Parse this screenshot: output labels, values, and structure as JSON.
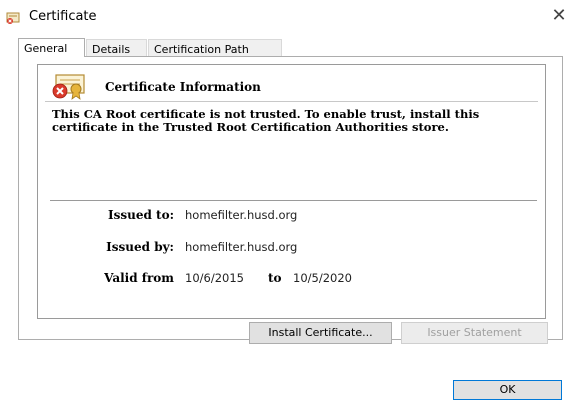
{
  "window": {
    "title": "Certificate",
    "close_glyph": "✕",
    "title_icon": "certificate-icon"
  },
  "tabs": [
    {
      "label": "General",
      "selected": true
    },
    {
      "label": "Details",
      "selected": false
    },
    {
      "label": "Certification Path",
      "selected": false
    }
  ],
  "general": {
    "heading": "Certificate Information",
    "status_icon": "certificate-untrusted-icon",
    "message": "This CA Root certificate is not trusted. To enable trust, install this certificate in the Trusted Root Certification Authorities store.",
    "issued_to_label": "Issued to:",
    "issued_to": "homefilter.husd.org",
    "issued_by_label": "Issued by:",
    "issued_by": "homefilter.husd.org",
    "valid_from_label": "Valid from",
    "valid_from": "10/6/2015",
    "valid_to_label": "to",
    "valid_to": "10/5/2020"
  },
  "buttons": {
    "install": "Install Certificate...",
    "issuer_statement": "Issuer Statement",
    "issuer_statement_enabled": false,
    "ok": "OK"
  },
  "colors": {
    "accent": "#0078d7",
    "error_red": "#d93a2b",
    "cert_gold": "#e6b43a"
  }
}
